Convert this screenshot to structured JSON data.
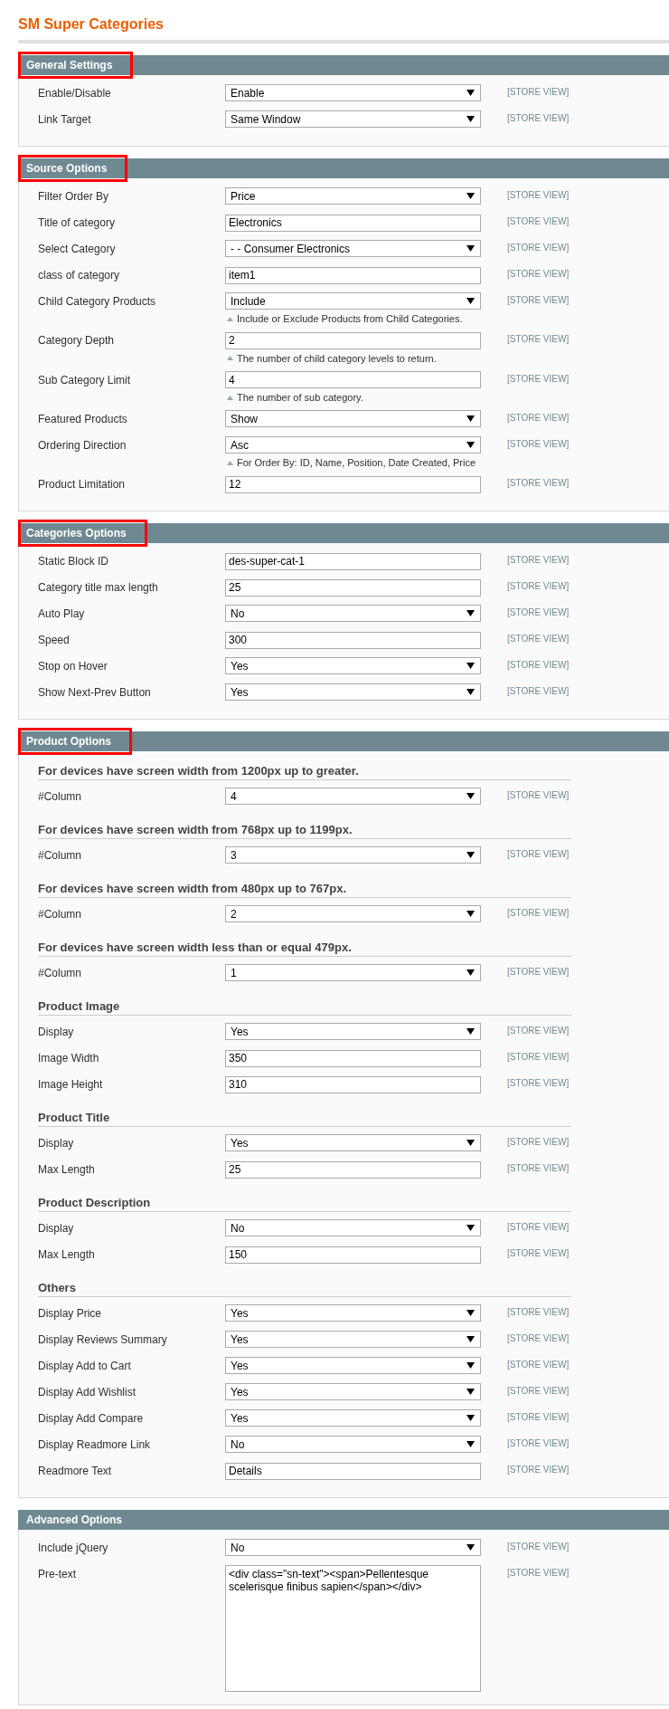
{
  "page_title": "SM Super Categories",
  "sections": [
    {
      "title": "General Settings",
      "highlighted": true,
      "rows": [
        {
          "kind": "select",
          "label": "Enable/Disable",
          "value": "Enable",
          "scope": "[STORE VIEW]"
        },
        {
          "kind": "select",
          "label": "Link Target",
          "value": "Same Window",
          "scope": "[STORE VIEW]"
        }
      ]
    },
    {
      "title": "Source Options",
      "highlighted": true,
      "rows": [
        {
          "kind": "select",
          "label": "Filter Order By",
          "value": "Price",
          "scope": "[STORE VIEW]"
        },
        {
          "kind": "text",
          "label": "Title of category",
          "value": "Electronics",
          "scope": "[STORE VIEW]"
        },
        {
          "kind": "select",
          "label": "Select Category",
          "value": "- - Consumer Electronics",
          "scope": "[STORE VIEW]"
        },
        {
          "kind": "text",
          "label": "class of category",
          "value": "item1",
          "scope": "[STORE VIEW]"
        },
        {
          "kind": "select",
          "label": "Child Category Products",
          "value": "Include",
          "scope": "[STORE VIEW]",
          "note": "Include or Exclude Products from Child Categories."
        },
        {
          "kind": "text",
          "label": "Category Depth",
          "value": "2",
          "scope": "[STORE VIEW]",
          "note": "The number of child category levels to return."
        },
        {
          "kind": "text",
          "label": "Sub Category Limit",
          "value": "4",
          "scope": "[STORE VIEW]",
          "note": "The number of sub category."
        },
        {
          "kind": "select",
          "label": "Featured Products",
          "value": "Show",
          "scope": "[STORE VIEW]"
        },
        {
          "kind": "select",
          "label": "Ordering Direction",
          "value": "Asc",
          "scope": "[STORE VIEW]",
          "note": "For Order By: ID, Name, Position, Date Created, Price"
        },
        {
          "kind": "text",
          "label": "Product Limitation",
          "value": "12",
          "scope": "[STORE VIEW]"
        }
      ]
    },
    {
      "title": "Categories Options",
      "highlighted": true,
      "rows": [
        {
          "kind": "text",
          "label": "Static Block ID",
          "value": "des-super-cat-1",
          "scope": "[STORE VIEW]"
        },
        {
          "kind": "text",
          "label": "Category title max length",
          "value": "25",
          "scope": "[STORE VIEW]"
        },
        {
          "kind": "select",
          "label": "Auto Play",
          "value": "No",
          "scope": "[STORE VIEW]"
        },
        {
          "kind": "text",
          "label": "Speed",
          "value": "300",
          "scope": "[STORE VIEW]"
        },
        {
          "kind": "select",
          "label": "Stop on Hover",
          "value": "Yes",
          "scope": "[STORE VIEW]"
        },
        {
          "kind": "select",
          "label": "Show Next-Prev Button",
          "value": "Yes",
          "scope": "[STORE VIEW]"
        }
      ]
    },
    {
      "title": "Product Options",
      "highlighted": true,
      "rows": [
        {
          "kind": "heading",
          "label": "For devices have screen width from 1200px up to greater."
        },
        {
          "kind": "select",
          "label": "#Column",
          "value": "4",
          "scope": "[STORE VIEW]"
        },
        {
          "kind": "heading",
          "label": "For devices have screen width from 768px up to 1199px."
        },
        {
          "kind": "select",
          "label": "#Column",
          "value": "3",
          "scope": "[STORE VIEW]"
        },
        {
          "kind": "heading",
          "label": "For devices have screen width from 480px up to 767px."
        },
        {
          "kind": "select",
          "label": "#Column",
          "value": "2",
          "scope": "[STORE VIEW]"
        },
        {
          "kind": "heading",
          "label": "For devices have screen width less than or equal 479px."
        },
        {
          "kind": "select",
          "label": "#Column",
          "value": "1",
          "scope": "[STORE VIEW]"
        },
        {
          "kind": "heading",
          "label": "Product Image"
        },
        {
          "kind": "select",
          "label": "Display",
          "value": "Yes",
          "scope": "[STORE VIEW]"
        },
        {
          "kind": "text",
          "label": "Image Width",
          "value": "350",
          "scope": "[STORE VIEW]"
        },
        {
          "kind": "text",
          "label": "Image Height",
          "value": "310",
          "scope": "[STORE VIEW]"
        },
        {
          "kind": "heading",
          "label": "Product Title"
        },
        {
          "kind": "select",
          "label": "Display",
          "value": "Yes",
          "scope": "[STORE VIEW]"
        },
        {
          "kind": "text",
          "label": "Max Length",
          "value": "25",
          "scope": "[STORE VIEW]"
        },
        {
          "kind": "heading",
          "label": "Product Description"
        },
        {
          "kind": "select",
          "label": "Display",
          "value": "No",
          "scope": "[STORE VIEW]"
        },
        {
          "kind": "text",
          "label": "Max Length",
          "value": "150",
          "scope": "[STORE VIEW]"
        },
        {
          "kind": "heading",
          "label": "Others"
        },
        {
          "kind": "select",
          "label": "Display Price",
          "value": "Yes",
          "scope": "[STORE VIEW]"
        },
        {
          "kind": "select",
          "label": "Display Reviews Summary",
          "value": "Yes",
          "scope": "[STORE VIEW]"
        },
        {
          "kind": "select",
          "label": "Display Add to Cart",
          "value": "Yes",
          "scope": "[STORE VIEW]"
        },
        {
          "kind": "select",
          "label": "Display Add Wishlist",
          "value": "Yes",
          "scope": "[STORE VIEW]"
        },
        {
          "kind": "select",
          "label": "Display Add Compare",
          "value": "Yes",
          "scope": "[STORE VIEW]"
        },
        {
          "kind": "select",
          "label": "Display Readmore Link",
          "value": "No",
          "scope": "[STORE VIEW]"
        },
        {
          "kind": "text",
          "label": "Readmore Text",
          "value": "Details",
          "scope": "[STORE VIEW]"
        }
      ]
    },
    {
      "title": "Advanced Options",
      "highlighted": false,
      "rows": [
        {
          "kind": "select",
          "label": "Include jQuery",
          "value": "No",
          "scope": "[STORE VIEW]"
        },
        {
          "kind": "textarea",
          "label": "Pre-text",
          "value": "<div class=\"sn-text\"><span>Pellentesque scelerisque finibus sapien</span></div>",
          "scope": "[STORE VIEW]"
        }
      ]
    }
  ]
}
